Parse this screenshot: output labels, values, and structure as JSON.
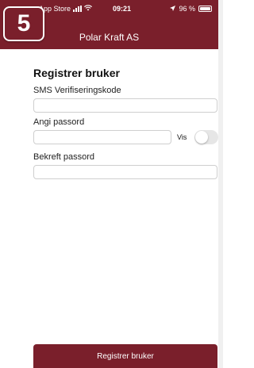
{
  "status_bar": {
    "carrier": "App Store",
    "time": "09:21",
    "battery": "96 %"
  },
  "header": {
    "title": "Polar Kraft AS"
  },
  "step_badge": "5",
  "form": {
    "heading": "Registrer bruker",
    "sms_label": "SMS Verifiseringskode",
    "sms_value": "",
    "password_label": "Angi passord",
    "password_value": "",
    "show_label": "Vis",
    "show_toggle_on": false,
    "confirm_label": "Bekreft passord",
    "confirm_value": ""
  },
  "submit_label": "Registrer bruker",
  "colors": {
    "brand": "#7a1f2b"
  }
}
